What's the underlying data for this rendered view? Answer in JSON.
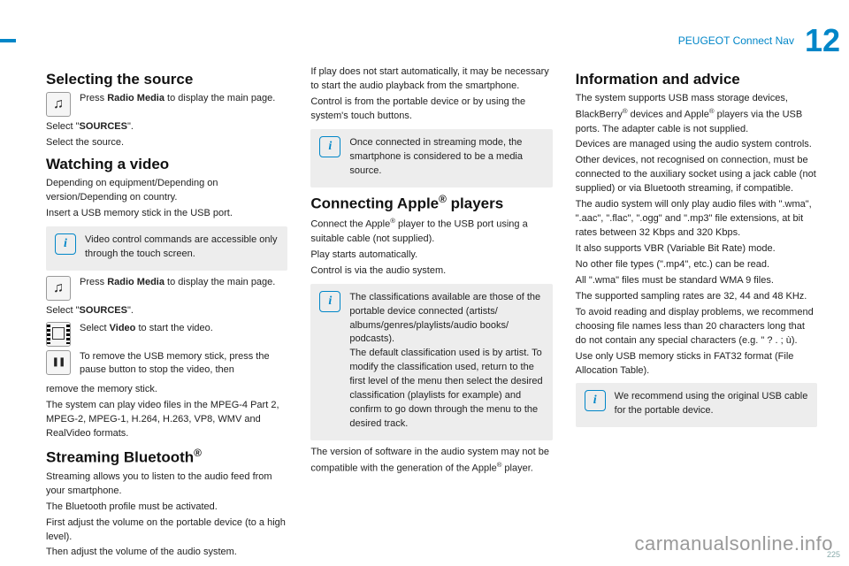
{
  "header": {
    "title": "PEUGEOT Connect Nav",
    "chapter": "12"
  },
  "col1": {
    "h1": "Selecting the source",
    "radio1_text": "Press Radio Media to display the main page.",
    "radio1_bold": "Radio Media",
    "select_sources": "Select \"SOURCES\".",
    "select_source": "Select the source.",
    "h2": "Watching a video",
    "video_p1": "Depending on equipment/Depending on version/Depending on country.",
    "video_p2": "Insert a USB memory stick in the USB port.",
    "info1": "Video control commands are accessible only through the touch screen.",
    "radio2_text": "Press Radio Media to display the main page.",
    "select_sources2": "Select \"SOURCES\".",
    "select_video": "Select Video to start the video.",
    "pause_text": "To remove the USB memory stick, press the pause button to stop the video, then remove the memory stick.",
    "video_formats": "The system can play video files in the MPEG-4 Part 2, MPEG-2, MPEG-1, H.264, H.263, VP8, WMV and RealVideo formats.",
    "h3": "Streaming Bluetooth®",
    "bt_p1": "Streaming allows you to listen to the audio feed from your smartphone.",
    "bt_p2": "The Bluetooth profile must be activated.",
    "bt_p3": "First adjust the volume on the portable device (to a high level).",
    "bt_p4": "Then adjust the volume of the audio system."
  },
  "col2": {
    "bt_p5": "If play does not start automatically, it may be necessary to start the audio playback from the smartphone.",
    "bt_p6": "Control is from the portable device or by using the system's touch buttons.",
    "info2": "Once connected in streaming mode, the smartphone is considered to be a media source.",
    "h4": "Connecting Apple® players",
    "ap_p1": "Connect the Apple® player to the USB port using a suitable cable (not supplied).",
    "ap_p2": "Play starts automatically.",
    "ap_p3": "Control is via the audio system.",
    "info3": "The classifications available are those of the portable device connected (artists/albums/genres/playlists/audio books/podcasts).\nThe default classification used is by artist. To modify the classification used, return to the first level of the menu then select the desired classification (playlists for example) and confirm to go down through the menu to the desired track.",
    "ap_p4": "The version of software in the audio system may not be compatible with the generation of the Apple® player."
  },
  "col3": {
    "h5": "Information and advice",
    "ia_p1": "The system supports USB mass storage devices, BlackBerry® devices and Apple® players via the USB ports. The adapter cable is not supplied.",
    "ia_p2": "Devices are managed using the audio system controls.",
    "ia_p3": "Other devices, not recognised on connection, must be connected to the auxiliary socket using a jack cable (not supplied) or via Bluetooth streaming, if compatible.",
    "ia_p4": "The audio system will only play audio files with \".wma\", \".aac\", \".flac\", \".ogg\" and \".mp3\" file extensions, at bit rates between 32 Kbps and 320 Kbps.",
    "ia_p5": "It also supports VBR (Variable Bit Rate) mode.",
    "ia_p6": "No other file types (\".mp4\", etc.) can be read.",
    "ia_p7": "All \".wma\" files must be standard WMA 9 files.",
    "ia_p8": "The supported sampling rates are 32, 44 and 48 KHz.",
    "ia_p9": "To avoid reading and display problems, we recommend choosing file names less than 20 characters long that do not contain any special characters (e.g. \" ? . ; ù).",
    "ia_p10": "Use only USB memory sticks in FAT32 format (File Allocation Table).",
    "info4": "We recommend using the original USB cable for the portable device."
  },
  "footer": {
    "watermark": "carmanualsonline.info",
    "page": "225"
  }
}
